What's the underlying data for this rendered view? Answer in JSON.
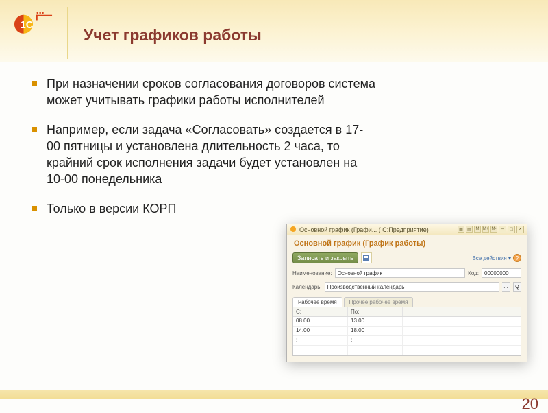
{
  "title": "Учет графиков работы",
  "bullets": [
    "При назначении сроков согласования договоров система может учитывать графики работы исполнителей",
    "Например, если задача «Согласовать» создается в 17-00 пятницы и установлена длительность 2 часа, то крайний срок исполнения задачи будет установлен на 10-00 понедельника",
    "Только в версии КОРП"
  ],
  "win": {
    "titlebar": "Основной график (Графи...  ( С:Предприятие)",
    "subtitle": "Основной график (График работы)",
    "save_btn": "Записать и закрыть",
    "all_actions": "Все действия ▾",
    "rows": {
      "name_label": "Наименование:",
      "name_value": "Основной график",
      "code_label": "Код:",
      "code_value": "00000000",
      "calendar_label": "Календарь:",
      "calendar_value": "Производственный календарь"
    },
    "tabs": {
      "active": "Рабочее время",
      "inactive": "Прочее рабочее время"
    },
    "table": {
      "col_from": "С:",
      "col_to": "По:",
      "rows": [
        {
          "from": "08.00",
          "to": "13.00"
        },
        {
          "from": "14.00",
          "to": "18.00"
        },
        {
          "from": ":",
          "to": ":"
        },
        {
          "from": "",
          "to": ""
        }
      ]
    }
  },
  "page_number": "20"
}
